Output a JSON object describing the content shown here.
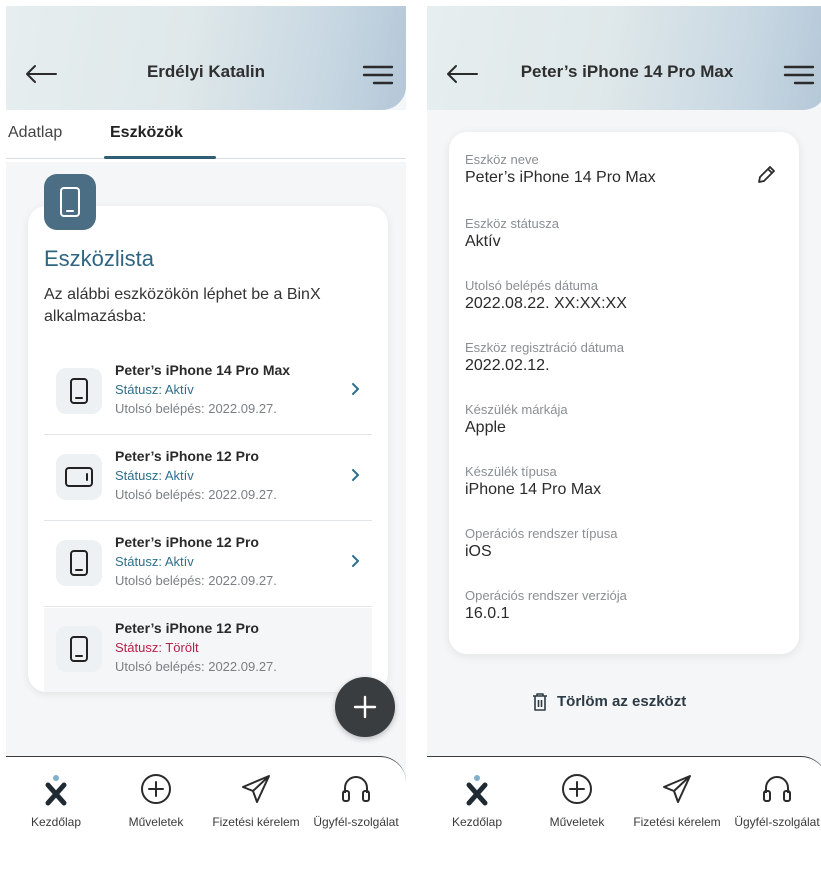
{
  "left_screen": {
    "header": {
      "title": "Erdélyi Katalin"
    },
    "tabs": [
      {
        "label": "Adatlap"
      },
      {
        "label": "Eszközök"
      }
    ],
    "device_list": {
      "title": "Eszközlista",
      "description": "Az alábbi eszközökön léphet be a BinX alkalmazásba:",
      "devices": [
        {
          "name": "Peter’s iPhone 14 Pro Max",
          "status": "Státusz: Aktív",
          "last_login": "Utolsó belépés: 2022.09.27.",
          "icon": "phone-icon"
        },
        {
          "name": "Peter’s iPhone 12 Pro",
          "status": "Státusz: Aktív",
          "last_login": "Utolsó belépés: 2022.09.27.",
          "icon": "tablet-icon"
        },
        {
          "name": "Peter’s iPhone 12 Pro",
          "status": "Státusz: Aktív",
          "last_login": "Utolsó belépés: 2022.09.27.",
          "icon": "phone-icon"
        },
        {
          "name": "Peter’s iPhone 12 Pro",
          "status": "Státusz: Törölt",
          "last_login": "Utolsó belépés: 2022.09.27.",
          "icon": "phone-icon"
        }
      ]
    }
  },
  "right_screen": {
    "header": {
      "title": "Peter’s iPhone 14 Pro Max"
    },
    "fields": [
      {
        "label": "Eszköz neve",
        "value": "Peter’s iPhone 14 Pro Max"
      },
      {
        "label": "Eszköz státusza",
        "value": "Aktív"
      },
      {
        "label": "Utolsó belépés dátuma",
        "value": "2022.08.22. XX:XX:XX"
      },
      {
        "label": "Eszköz regisztráció dátuma",
        "value": "2022.02.12."
      },
      {
        "label": "Készülék márkája",
        "value": "Apple"
      },
      {
        "label": "Készülék típusa",
        "value": "iPhone 14 Pro Max"
      },
      {
        "label": "Operációs rendszer típusa",
        "value": "iOS"
      },
      {
        "label": "Operációs rendszer verziója",
        "value": "16.0.1"
      }
    ],
    "delete_label": "Törlöm az eszközt"
  },
  "bottom_nav": [
    {
      "label": "Kezdőlap",
      "icon": "binx-logo-icon"
    },
    {
      "label": "Műveletek",
      "icon": "plus-circle-icon"
    },
    {
      "label": "Fizetési kérelem",
      "icon": "send-icon"
    },
    {
      "label": "Ügyfél-szolgálat",
      "icon": "headset-icon"
    }
  ],
  "colors": {
    "accent": "#2e6582",
    "status_active": "#2d6f8c",
    "status_deleted": "#b8204a",
    "fab": "#3a3d40",
    "badge": "#4b6e84"
  }
}
